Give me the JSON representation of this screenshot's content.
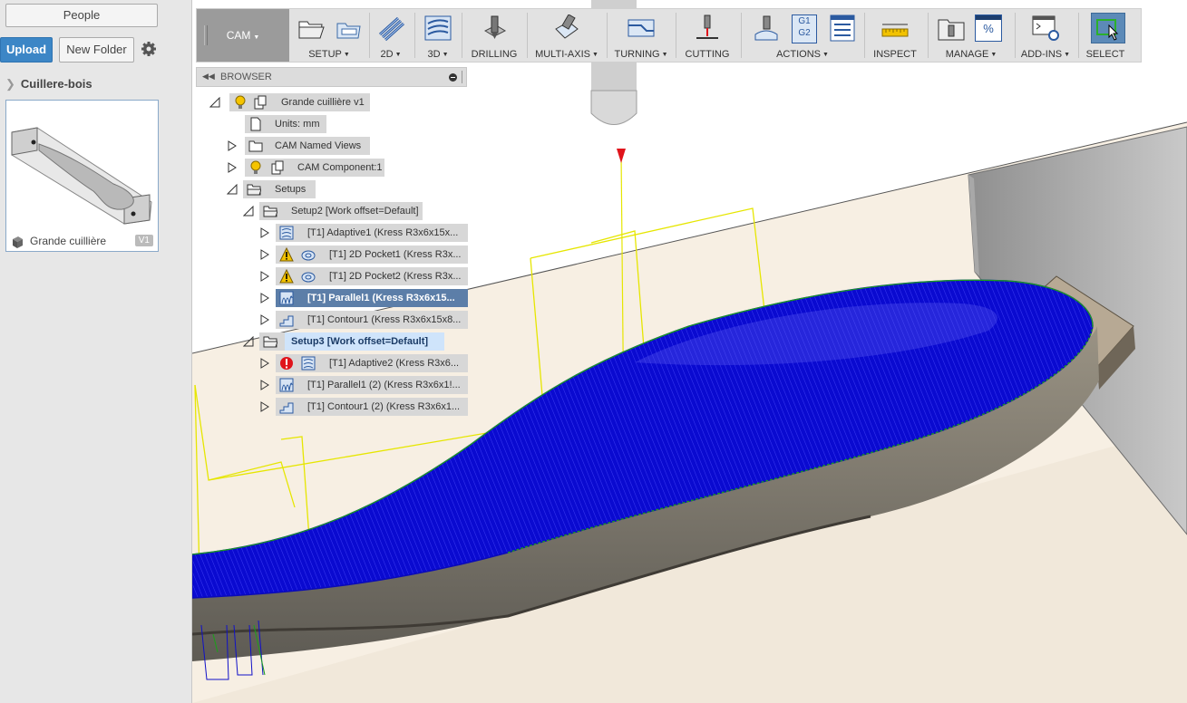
{
  "left_panel": {
    "people_button": "People",
    "upload_button": "Upload",
    "new_folder_button": "New Folder",
    "breadcrumb": "Cuillere-bois",
    "file_card": {
      "name": "Grande cuillière",
      "version": "V1"
    }
  },
  "toolbar": {
    "workspace": "CAM",
    "groups": [
      {
        "id": "setup",
        "label": "SETUP",
        "dropdown": true
      },
      {
        "id": "2d",
        "label": "2D",
        "dropdown": true
      },
      {
        "id": "3d",
        "label": "3D",
        "dropdown": true
      },
      {
        "id": "drilling",
        "label": "DRILLING",
        "dropdown": false
      },
      {
        "id": "multiaxis",
        "label": "MULTI-AXIS",
        "dropdown": true
      },
      {
        "id": "turning",
        "label": "TURNING",
        "dropdown": true
      },
      {
        "id": "cutting",
        "label": "CUTTING",
        "dropdown": false
      },
      {
        "id": "actions",
        "label": "ACTIONS",
        "dropdown": true
      },
      {
        "id": "inspect",
        "label": "INSPECT",
        "dropdown": false
      },
      {
        "id": "manage",
        "label": "MANAGE",
        "dropdown": true
      },
      {
        "id": "addins",
        "label": "ADD-INS",
        "dropdown": true
      },
      {
        "id": "select",
        "label": "SELECT",
        "dropdown": false
      }
    ],
    "actions_icon_text": [
      "G1",
      "G2"
    ],
    "manage_icon_text": "%"
  },
  "browser": {
    "title": "BROWSER",
    "tree": [
      {
        "id": "root",
        "label": "Grande cuillière v1"
      },
      {
        "id": "units",
        "label": "Units: mm"
      },
      {
        "id": "named_views",
        "label": "CAM Named Views"
      },
      {
        "id": "component",
        "label": "CAM Component:1"
      },
      {
        "id": "setups",
        "label": "Setups"
      },
      {
        "id": "setup2",
        "label": "Setup2 [Work offset=Default]"
      },
      {
        "id": "adaptive1",
        "label": "[T1] Adaptive1 (Kress R3x6x15x..."
      },
      {
        "id": "pocket1",
        "label": "[T1] 2D Pocket1 (Kress R3x..."
      },
      {
        "id": "pocket2",
        "label": "[T1] 2D Pocket2 (Kress R3x..."
      },
      {
        "id": "parallel1",
        "label": "[T1] Parallel1 (Kress R3x6x15..."
      },
      {
        "id": "contour1",
        "label": "[T1] Contour1 (Kress R3x6x15x8..."
      },
      {
        "id": "setup3",
        "label": "Setup3 [Work offset=Default]"
      },
      {
        "id": "adaptive2",
        "label": "[T1] Adaptive2 (Kress R3x6..."
      },
      {
        "id": "parallel1b",
        "label": "[T1] Parallel1 (2) (Kress R3x6x1!..."
      },
      {
        "id": "contour1b",
        "label": "[T1] Contour1 (2) (Kress R3x6x1..."
      }
    ]
  },
  "colors": {
    "toolpath": "#1010e0",
    "boundary": "#e6e600",
    "stock": "#f6eee2",
    "warning": "#f2c200",
    "error": "#e0141b",
    "selection": "#5c7ea8"
  }
}
